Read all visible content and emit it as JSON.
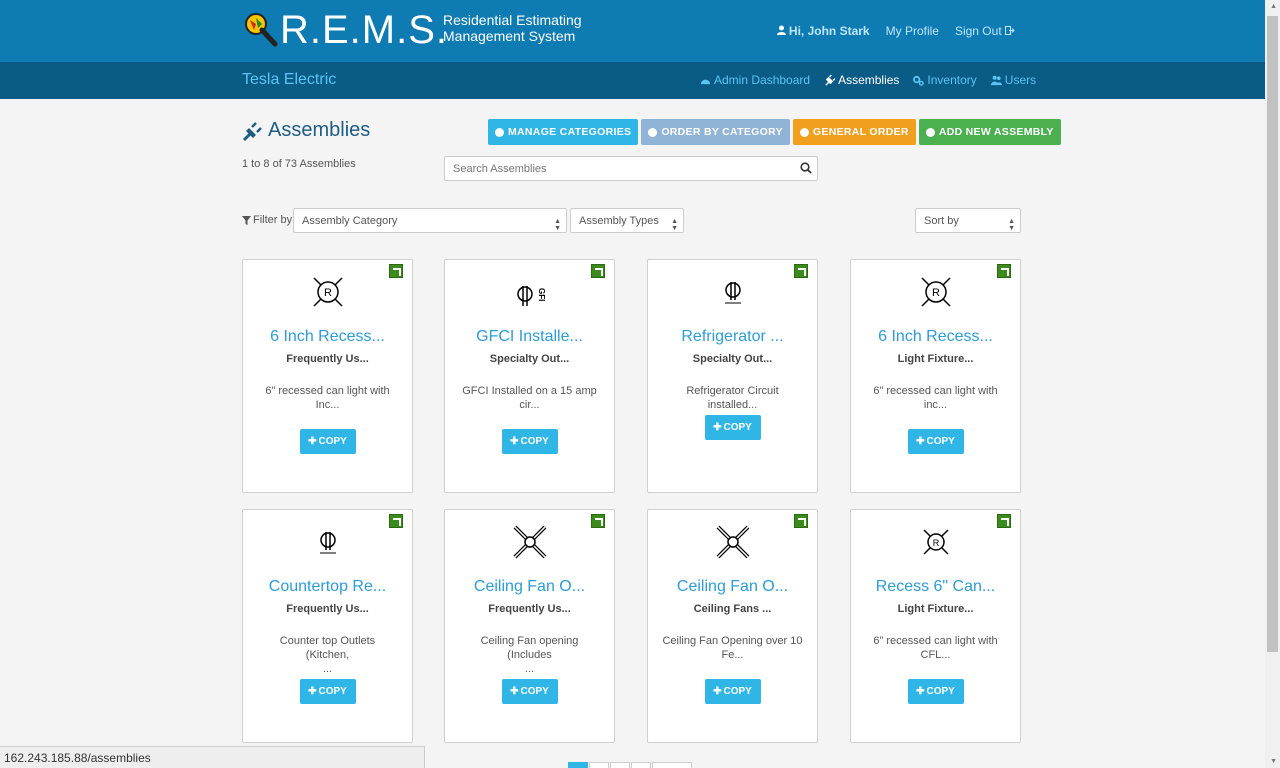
{
  "header": {
    "logo_text": "R.E.M.S.",
    "subtitle_line1": "Residential Estimating",
    "subtitle_line2": "Management System",
    "greeting": "Hi, John Stark",
    "profile_label": "My Profile",
    "signout_label": "Sign Out"
  },
  "subnav": {
    "company": "Tesla Electric",
    "links": [
      "Admin Dashboard",
      "Assemblies",
      "Inventory",
      "Users"
    ]
  },
  "page": {
    "title": "Assemblies",
    "count": "1 to 8 of 73 Assemblies",
    "buttons": [
      "MANAGE CATEGORIES",
      "ORDER BY CATEGORY",
      "GENERAL ORDER",
      "ADD NEW ASSEMBLY"
    ],
    "search_placeholder": "Search Assemblies",
    "filter_label": "Filter by",
    "category_select": "Assembly Category",
    "type_select": "Assembly Types",
    "sort_select": "Sort by"
  },
  "cards": [
    {
      "name": "6 Inch Recess...",
      "category": "Frequently Us...",
      "desc1": "6\" recessed can light with",
      "desc2": "Inc...",
      "icon": "recessed-light-icon",
      "copy": "COPY"
    },
    {
      "name": "GFCI Installe...",
      "category": "Specialty Out...",
      "desc1": "GFCI Installed on a 15 amp",
      "desc2": "cir...",
      "icon": "gfci-outlet-icon",
      "copy": "COPY"
    },
    {
      "name": "Refrigerator ...",
      "category": "Specialty Out...",
      "desc1": "Refrigerator Circuit installed...",
      "desc2": "",
      "icon": "dedicated-outlet-icon",
      "copy": "COPY"
    },
    {
      "name": "6 Inch Recess...",
      "category": "Light Fixture...",
      "desc1": "6\" recessed can light with",
      "desc2": "inc...",
      "icon": "recessed-light-icon",
      "copy": "COPY"
    },
    {
      "name": "Countertop Re...",
      "category": "Frequently Us...",
      "desc1": "Counter top Outlets (Kitchen,",
      "desc2": "...",
      "icon": "countertop-outlet-icon",
      "copy": "COPY"
    },
    {
      "name": "Ceiling Fan O...",
      "category": "Frequently Us...",
      "desc1": "Ceiling Fan opening (Includes",
      "desc2": "...",
      "icon": "ceiling-fan-icon",
      "copy": "COPY"
    },
    {
      "name": "Ceiling Fan O...",
      "category": "Ceiling Fans ...",
      "desc1": "Ceiling Fan Opening over 10",
      "desc2": "Fe...",
      "icon": "ceiling-fan-icon",
      "copy": "COPY"
    },
    {
      "name": "Recess 6\" Can...",
      "category": "Light Fixture...",
      "desc1": "6\" recessed can light with",
      "desc2": "CFL...",
      "icon": "recessed-light-icon",
      "copy": "COPY"
    }
  ],
  "status_url": "162.243.185.88/assemblies",
  "colors": {
    "header": "#0e7bb3",
    "subnav": "#0a5c86",
    "accent": "#2fb6e6",
    "orange": "#f0a01c",
    "green": "#4caf50"
  }
}
